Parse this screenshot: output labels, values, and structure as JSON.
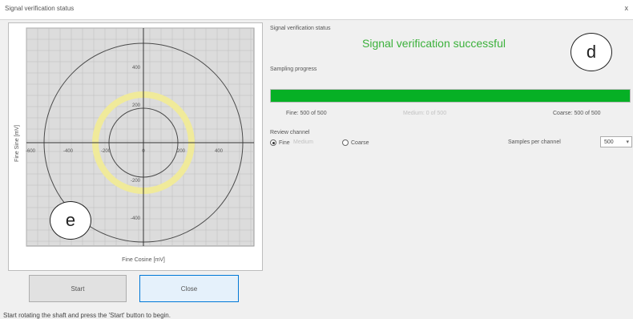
{
  "window": {
    "title": "Signal verification status",
    "close_glyph": "x"
  },
  "plot": {
    "y_axis_label": "Fine Sine [mV]",
    "x_axis_label": "Fine Cosine [mV]",
    "x_ticks": [
      "-600",
      "-400",
      "-200",
      "0",
      "200",
      "400"
    ],
    "y_ticks": [
      "400",
      "200",
      "-200",
      "-400"
    ],
    "colors": {
      "background": "#dcdcdc",
      "grid": "#bdbdbd",
      "circle": "#4a4a4a",
      "ring": "#f0ea9a",
      "axis": "#333333"
    }
  },
  "buttons": {
    "start_label": "Start",
    "close_label": "Close"
  },
  "status_bar": {
    "text": "Start rotating the shaft and press the 'Start' button to begin."
  },
  "verification": {
    "section_label": "Signal verification status",
    "message": "Signal verification successful",
    "sampling_label": "Sampling progress",
    "progress_fraction": 1.0,
    "fine_count": "Fine: 500 of 500",
    "medium_count": "Medium: 0 of 500",
    "coarse_count": "Coarse: 500 of 500"
  },
  "review": {
    "label": "Review channel",
    "options": [
      {
        "label": "Fine",
        "selected": true,
        "enabled": true
      },
      {
        "label": "Medium",
        "selected": false,
        "enabled": false
      },
      {
        "label": "Coarse",
        "selected": false,
        "enabled": true
      }
    ],
    "samples_label": "Samples per channel",
    "samples_value": "500"
  },
  "callouts": {
    "d": "d",
    "e": "e"
  }
}
